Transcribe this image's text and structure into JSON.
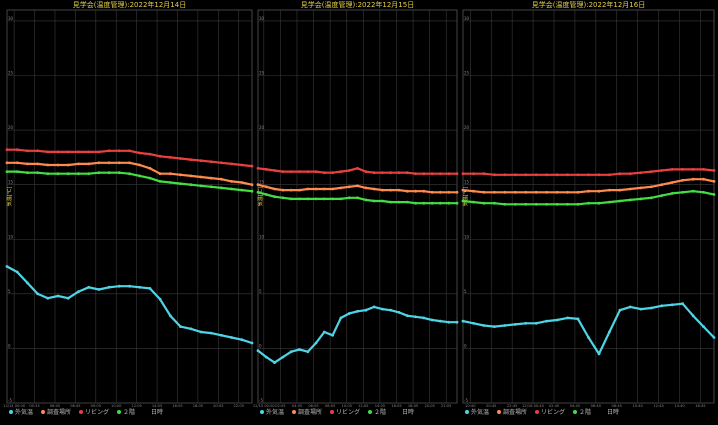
{
  "legend_items": [
    {
      "label": "外気温",
      "color": "#4fd4e6"
    },
    {
      "label": "調査場所",
      "color": "#ff8a4d"
    },
    {
      "label": "リビング",
      "color": "#e84040"
    },
    {
      "label": "２階",
      "color": "#44dd44"
    }
  ],
  "xlabel": "日時",
  "ylabel": "気温[℃]",
  "chart_data": [
    {
      "type": "line",
      "title": "見学会(温度管理):2022年12月14日",
      "ylabel": "気温[℃]",
      "xlabel": "日時",
      "ylim": [
        -5,
        31
      ],
      "yticks": [
        -5,
        0,
        5,
        10,
        15,
        20,
        25,
        30
      ],
      "grid": true,
      "legend": "bottom-left",
      "x_tick_labels": [
        "12/14 00:00",
        "00:35",
        "06:05",
        "06:45",
        "09:05",
        "10:00",
        "12:05",
        "14:05",
        "16:05",
        "18:05",
        "20:05",
        "22:05"
      ],
      "x": [
        0,
        1,
        2,
        3,
        4,
        5,
        6,
        7,
        8,
        9,
        10,
        11,
        12,
        13,
        14,
        15,
        16,
        17,
        18,
        19,
        20,
        21,
        22,
        23,
        24
      ],
      "series": [
        {
          "name": "外気温",
          "color": "#4fd4e6",
          "values": [
            7.5,
            7.0,
            6.0,
            5.0,
            4.6,
            4.8,
            4.6,
            5.2,
            5.6,
            5.4,
            5.6,
            5.7,
            5.7,
            5.6,
            5.5,
            4.5,
            3.0,
            2.0,
            1.8,
            1.5,
            1.4,
            1.2,
            1.0,
            0.8,
            0.5
          ]
        },
        {
          "name": "調査場所",
          "color": "#ff8a4d",
          "values": [
            17.0,
            17.0,
            16.9,
            16.9,
            16.8,
            16.8,
            16.8,
            16.9,
            16.9,
            17.0,
            17.0,
            17.0,
            17.0,
            16.8,
            16.5,
            16.0,
            16.0,
            15.9,
            15.8,
            15.7,
            15.6,
            15.5,
            15.3,
            15.2,
            15.0
          ]
        },
        {
          "name": "リビング",
          "color": "#e84040",
          "values": [
            18.2,
            18.2,
            18.1,
            18.1,
            18.0,
            18.0,
            18.0,
            18.0,
            18.0,
            18.0,
            18.1,
            18.1,
            18.1,
            17.9,
            17.8,
            17.6,
            17.5,
            17.4,
            17.3,
            17.2,
            17.1,
            17.0,
            16.9,
            16.8,
            16.7
          ]
        },
        {
          "name": "２階",
          "color": "#44dd44",
          "values": [
            16.2,
            16.2,
            16.1,
            16.1,
            16.0,
            16.0,
            16.0,
            16.0,
            16.0,
            16.1,
            16.1,
            16.1,
            16.0,
            15.8,
            15.6,
            15.3,
            15.2,
            15.1,
            15.0,
            14.9,
            14.8,
            14.7,
            14.6,
            14.5,
            14.4
          ]
        }
      ]
    },
    {
      "type": "line",
      "title": "見学会(温度管理):2022年12月15日",
      "ylabel": "気温[℃]",
      "xlabel": "日時",
      "ylim": [
        -5,
        31
      ],
      "yticks": [
        -5,
        0,
        5,
        10,
        15,
        20,
        25,
        30
      ],
      "grid": true,
      "legend": "bottom-left",
      "x_tick_labels": [
        "12/15 00:00",
        "02:05",
        "04:05",
        "06:05",
        "08:05",
        "10:05",
        "12:05",
        "14:05",
        "16:05",
        "18:05",
        "20:05",
        "22:05"
      ],
      "x": [
        0,
        1,
        2,
        3,
        4,
        5,
        6,
        7,
        8,
        9,
        10,
        11,
        12,
        13,
        14,
        15,
        16,
        17,
        18,
        19,
        20,
        21,
        22,
        23,
        24
      ],
      "series": [
        {
          "name": "外気温",
          "color": "#4fd4e6",
          "values": [
            -0.2,
            -0.8,
            -1.3,
            -0.8,
            -0.3,
            -0.1,
            -0.3,
            0.5,
            1.5,
            1.2,
            2.8,
            3.2,
            3.4,
            3.5,
            3.8,
            3.6,
            3.5,
            3.3,
            3.0,
            2.9,
            2.8,
            2.6,
            2.5,
            2.4,
            2.4
          ]
        },
        {
          "name": "調査場所",
          "color": "#ff8a4d",
          "values": [
            15.0,
            14.8,
            14.6,
            14.5,
            14.5,
            14.5,
            14.6,
            14.6,
            14.6,
            14.6,
            14.7,
            14.8,
            14.9,
            14.7,
            14.6,
            14.5,
            14.5,
            14.5,
            14.4,
            14.4,
            14.4,
            14.3,
            14.3,
            14.3,
            14.3
          ]
        },
        {
          "name": "リビング",
          "color": "#e84040",
          "values": [
            16.5,
            16.4,
            16.3,
            16.2,
            16.2,
            16.2,
            16.2,
            16.2,
            16.1,
            16.1,
            16.2,
            16.3,
            16.5,
            16.2,
            16.1,
            16.1,
            16.1,
            16.1,
            16.1,
            16.0,
            16.0,
            16.0,
            16.0,
            16.0,
            16.0
          ]
        },
        {
          "name": "２階",
          "color": "#44dd44",
          "values": [
            14.3,
            14.1,
            13.9,
            13.8,
            13.7,
            13.7,
            13.7,
            13.7,
            13.7,
            13.7,
            13.7,
            13.8,
            13.8,
            13.6,
            13.5,
            13.5,
            13.4,
            13.4,
            13.4,
            13.3,
            13.3,
            13.3,
            13.3,
            13.3,
            13.3
          ]
        }
      ]
    },
    {
      "type": "line",
      "title": "見学会(温度管理):2022年12月16日",
      "ylabel": "気温[℃]",
      "xlabel": "日時",
      "ylim": [
        -5,
        31
      ],
      "yticks": [
        -5,
        0,
        5,
        10,
        15,
        20,
        25,
        30
      ],
      "grid": true,
      "legend": "bottom-left",
      "x_tick_labels": [
        "10:40",
        "20:45",
        "22:45",
        "12/16 00:45",
        "02:45",
        "04:45",
        "06:40",
        "08:45",
        "10:40",
        "12:45",
        "14:40",
        "16:45"
      ],
      "x": [
        0,
        1,
        2,
        3,
        4,
        5,
        6,
        7,
        8,
        9,
        10,
        11,
        12,
        13,
        14,
        15,
        16,
        17,
        18,
        19,
        20,
        21,
        22,
        23,
        24
      ],
      "series": [
        {
          "name": "外気温",
          "color": "#4fd4e6",
          "values": [
            2.5,
            2.3,
            2.1,
            2.0,
            2.1,
            2.2,
            2.3,
            2.3,
            2.5,
            2.6,
            2.8,
            2.7,
            1.0,
            -0.5,
            1.5,
            3.5,
            3.8,
            3.6,
            3.7,
            3.9,
            4.0,
            4.1,
            3.0,
            2.0,
            1.0
          ]
        },
        {
          "name": "調査場所",
          "color": "#ff8a4d",
          "values": [
            14.5,
            14.4,
            14.3,
            14.3,
            14.3,
            14.3,
            14.3,
            14.3,
            14.3,
            14.3,
            14.3,
            14.3,
            14.4,
            14.4,
            14.5,
            14.5,
            14.6,
            14.7,
            14.8,
            15.0,
            15.2,
            15.4,
            15.5,
            15.5,
            15.3
          ]
        },
        {
          "name": "リビング",
          "color": "#e84040",
          "values": [
            16.0,
            16.0,
            16.0,
            15.9,
            15.9,
            15.9,
            15.9,
            15.9,
            15.9,
            15.9,
            15.9,
            15.9,
            15.9,
            15.9,
            15.9,
            16.0,
            16.0,
            16.1,
            16.2,
            16.3,
            16.4,
            16.4,
            16.4,
            16.4,
            16.3
          ]
        },
        {
          "name": "２階",
          "color": "#44dd44",
          "values": [
            13.5,
            13.4,
            13.3,
            13.3,
            13.2,
            13.2,
            13.2,
            13.2,
            13.2,
            13.2,
            13.2,
            13.2,
            13.3,
            13.3,
            13.4,
            13.5,
            13.6,
            13.7,
            13.8,
            14.0,
            14.2,
            14.3,
            14.4,
            14.3,
            14.1
          ]
        }
      ]
    }
  ]
}
